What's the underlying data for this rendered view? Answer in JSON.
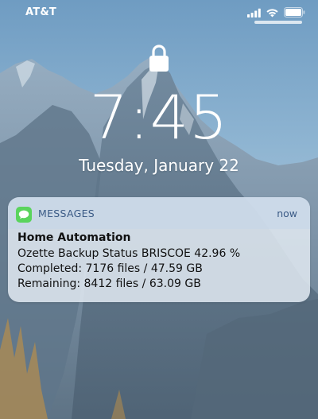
{
  "status_bar": {
    "carrier": "AT&T",
    "signal_icon": "signal-bars-icon",
    "wifi_icon": "wifi-icon",
    "battery_icon": "battery-icon"
  },
  "lock_screen": {
    "lock_icon": "lock-icon",
    "time": "7:45",
    "date": "Tuesday, January 22"
  },
  "notification": {
    "app_icon": "messages-icon",
    "app_name": "MESSAGES",
    "time": "now",
    "title": "Home Automation",
    "lines": [
      "Ozette Backup Status BRISCOE 42.96 %",
      "Completed: 7176 files / 47.59 GB",
      "Remaining: 8412 files / 63.09 GB"
    ]
  }
}
